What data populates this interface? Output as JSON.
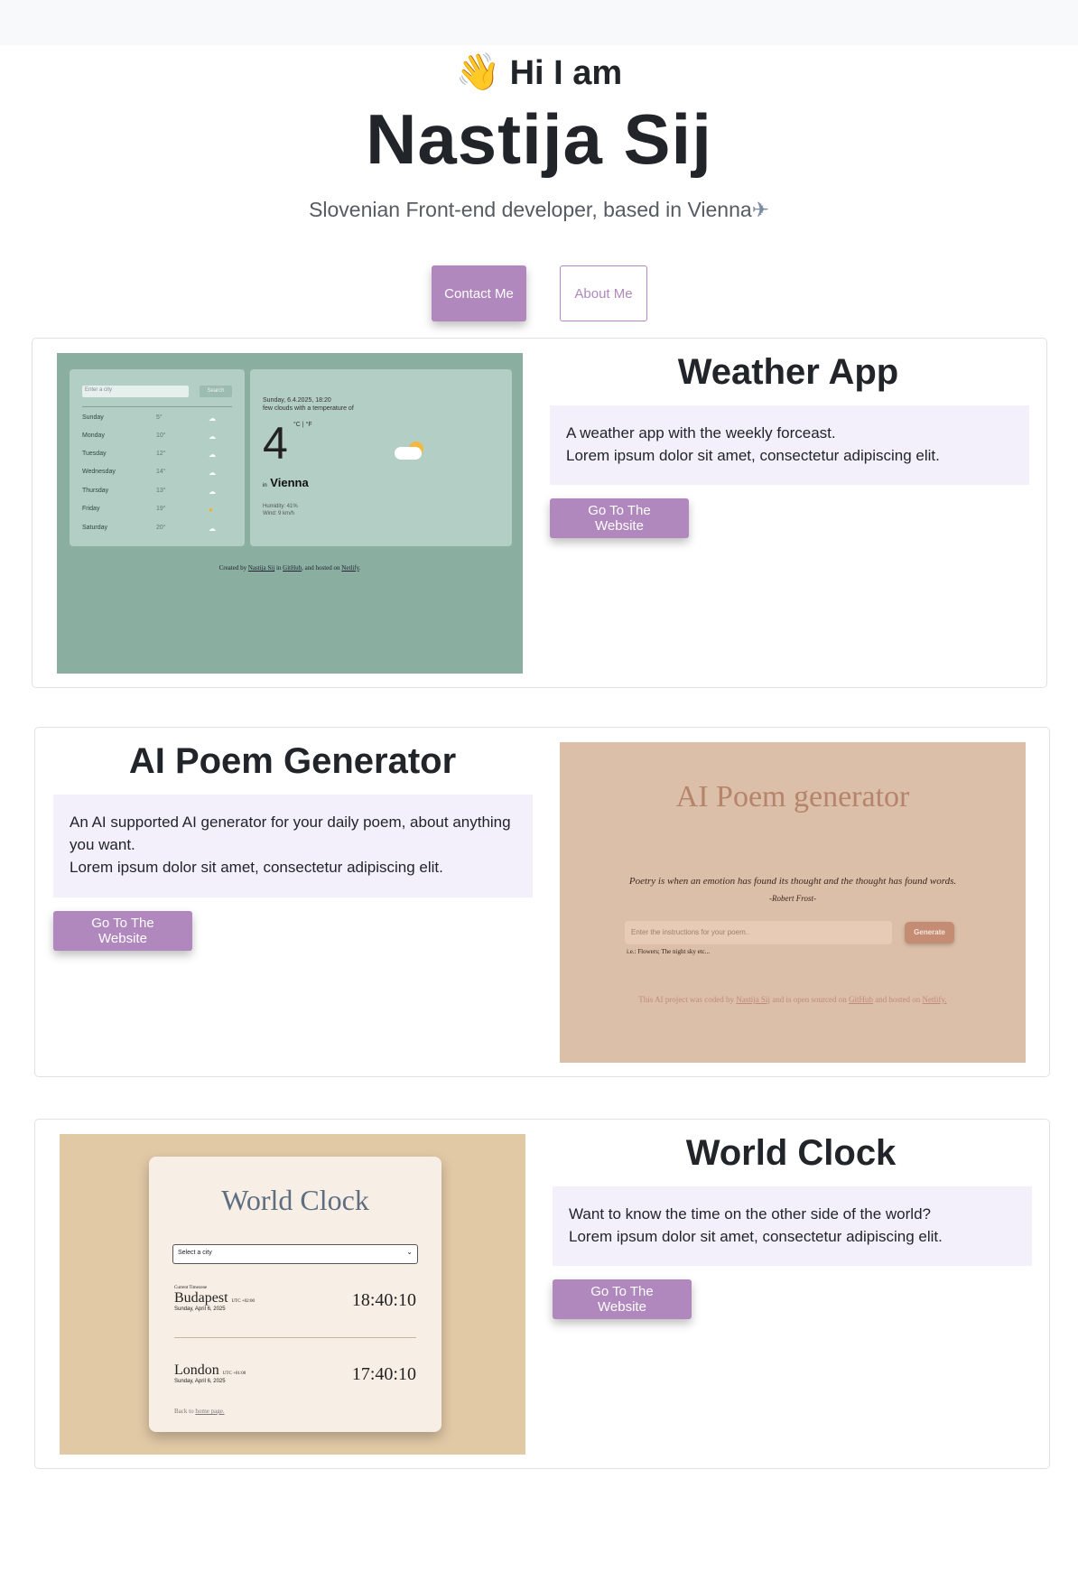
{
  "hero": {
    "greeting": "Hi I am",
    "wave_icon": "👋",
    "name": "Nastija Sij",
    "tagline": "Slovenian Front-end developer, based in Vienna",
    "plane_icon": "✈",
    "contact_label": "Contact Me",
    "about_label": "About Me"
  },
  "colors": {
    "accent": "#b088bd",
    "desc_bg": "#f4f0fb",
    "topbar": "#f8f9fa"
  },
  "projects": [
    {
      "title": "Weather App",
      "desc_line1": "A weather app with the weekly forceast.",
      "desc_line2": "Lorem ipsum dolor sit amet, consectetur adipiscing elit.",
      "button": "Go To The Website",
      "preview": {
        "search_placeholder": "Enter a city",
        "search_button": "Search",
        "days": [
          {
            "day": "Sunday",
            "temp": "5°"
          },
          {
            "day": "Monday",
            "temp": "10°"
          },
          {
            "day": "Tuesday",
            "temp": "12°"
          },
          {
            "day": "Wednesday",
            "temp": "14°"
          },
          {
            "day": "Thursday",
            "temp": "13°"
          },
          {
            "day": "Friday",
            "temp": "19°"
          },
          {
            "day": "Saturday",
            "temp": "20°"
          }
        ],
        "date_line": "Sunday, 6.4.2025, 18:20",
        "desc_line": "few clouds with a temperature of",
        "temperature": "4",
        "units": "°C | °F",
        "in_label": "in",
        "city": "Vienna",
        "humidity": "Humidity: 41%",
        "wind": "Wind: 9 km/h",
        "footer_pre": "Created by",
        "footer_name": "Nastija Sij",
        "footer_mid1": "in",
        "footer_github": "GitHub",
        "footer_mid2": ", and hosted on",
        "footer_host": "Netlify"
      }
    },
    {
      "title": "AI Poem Generator",
      "desc_line1": "An AI supported AI generator for your daily poem, about anything",
      "desc_line2": "you want.",
      "desc_line3": "Lorem ipsum dolor sit amet, consectetur adipiscing elit.",
      "button": "Go To The Website",
      "preview": {
        "title": "AI Poem generator",
        "quote": "Poetry is when an emotion has found its thought and the thought has found words.",
        "author": "-Robert Frost-",
        "input_placeholder": "Enter the instructions for your poem..",
        "generate": "Generate",
        "hint": "i.e.: Flowers; The night sky etc...",
        "footer_pre": "This AI project was coded by",
        "footer_name": "Nastija Sij",
        "footer_mid1": "and is open sourced on",
        "footer_github": "GitHub",
        "footer_mid2": "and hosted on",
        "footer_host": "Netlify."
      }
    },
    {
      "title": "World Clock",
      "desc_line1": "Want to know the time on the other side of the world?",
      "desc_line2": "Lorem ipsum dolor sit amet, consectetur adipiscing elit.",
      "button": "Go To The Website",
      "preview": {
        "title": "World Clock",
        "select": "Select a city",
        "current_label": "Current Timezone",
        "city1": "Budapest",
        "utc1": "UTC +02:00",
        "date1": "Sunday, April 6, 2025",
        "time1": "18:40:10",
        "city2": "London",
        "utc2": "UTC +01:00",
        "date2": "Sunday, April 6, 2025",
        "time2": "17:40:10",
        "back_pre": "Back to",
        "back_link": "home page."
      }
    }
  ]
}
